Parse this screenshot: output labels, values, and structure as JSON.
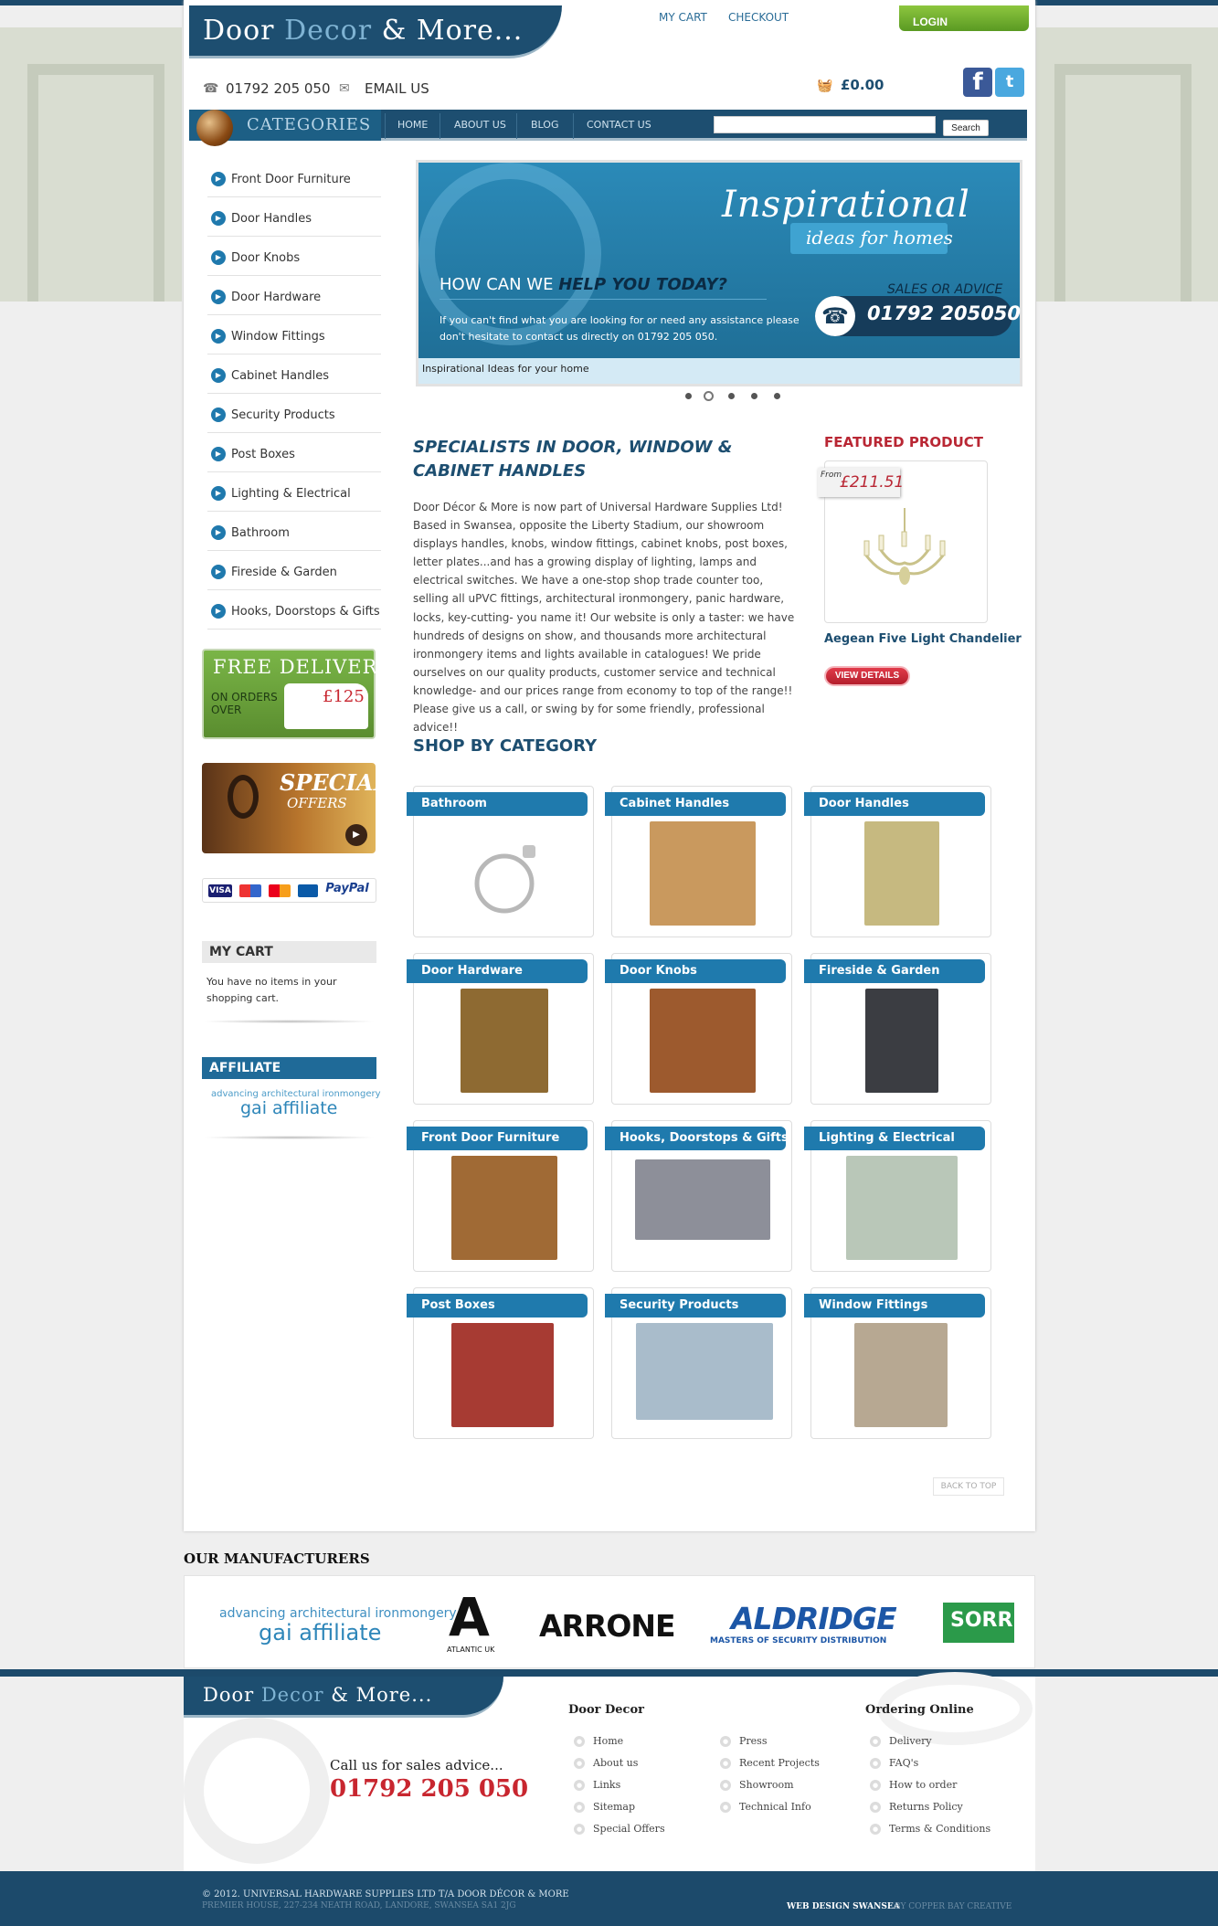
{
  "header": {
    "logo": {
      "part1": "Door ",
      "part2": "Decor",
      "part3": " & More..."
    },
    "links": {
      "my_cart": "MY CART",
      "checkout": "CHECKOUT",
      "login": "LOGIN"
    },
    "phone": "01792 205 050",
    "email": "EMAIL US",
    "cart_total": "£0.00",
    "social": {
      "facebook_glyph": "f",
      "twitter_glyph": "t"
    }
  },
  "nav": {
    "categories_title": "CATEGORIES",
    "items": [
      "HOME",
      "ABOUT US",
      "BLOG",
      "CONTACT US"
    ],
    "search": {
      "value": "",
      "button": "Search"
    }
  },
  "sidebar": {
    "categories": [
      "Front Door Furniture",
      "Door Handles",
      "Door Knobs",
      "Door Hardware",
      "Window Fittings",
      "Cabinet Handles",
      "Security Products",
      "Post Boxes",
      "Lighting & Electrical",
      "Bathroom",
      "Fireside & Garden",
      "Hooks, Doorstops & Gifts"
    ],
    "free_delivery": {
      "title": "FREE DELIVERY",
      "sub1": "ON ORDERS",
      "sub2": "OVER",
      "price": "£125"
    },
    "special_offers": {
      "title": "SPECIAL",
      "sub": "OFFERS"
    },
    "payments": [
      "VISA",
      "",
      "",
      "",
      "PayPal"
    ],
    "my_cart": {
      "title": "MY CART",
      "text": "You have no items in your shopping cart."
    },
    "affiliate": {
      "title": "AFFILIATE",
      "small": "advancing architectural ironmongery",
      "big": "gai affiliate"
    }
  },
  "banner": {
    "title": "Inspirational",
    "subtitle": "ideas for homes",
    "question_a": "HOW CAN WE ",
    "question_b": "HELP YOU TODAY?",
    "text": "If you can't find what you are looking for or need any assistance please don't hesitate to contact us directly on 01792 205 050.",
    "sales": "SALES OR ADVICE",
    "phone": "01792 205050",
    "caption": "Inspirational Ideas for your home",
    "active_slide": 2,
    "slide_count": 5
  },
  "intro": {
    "title": "SPECIALISTS IN DOOR, WINDOW & CABINET HANDLES",
    "body": "Door Décor & More is now part of Universal Hardware Supplies Ltd! Based in Swansea, opposite the Liberty Stadium, our showroom displays handles, knobs, window fittings, cabinet knobs, post boxes, letter plates...and has a growing display of lighting, lamps and electrical switches. We have a one-stop shop trade counter too, selling all uPVC fittings, architectural ironmongery, panic hardware, locks, key-cutting- you name it! Our website is only a taster: we have hundreds of designs on show, and thousands more architectural ironmongery items and lights available in catalogues! We pride ourselves on our quality products, customer service and technical knowledge- and our prices range from economy to top of the range!! Please give us a call, or swing by for some friendly, professional advice!!"
  },
  "featured": {
    "title": "FEATURED PRODUCT",
    "from": "From",
    "price": "£211.51",
    "name": "Aegean Five Light Chandelier",
    "button": "VIEW DETAILS"
  },
  "shop": {
    "title": "SHOP BY CATEGORY",
    "tiles": [
      {
        "label": "Bathroom",
        "color": "#f2f2f2"
      },
      {
        "label": "Cabinet Handles",
        "color": "#c9995e"
      },
      {
        "label": "Door Handles",
        "color": "#c6b980"
      },
      {
        "label": "Door Hardware",
        "color": "#8e6a32"
      },
      {
        "label": "Door Knobs",
        "color": "#9d5a2e"
      },
      {
        "label": "Fireside & Garden",
        "color": "#3b3d42"
      },
      {
        "label": "Front Door Furniture",
        "color": "#a06a35"
      },
      {
        "label": "Hooks, Doorstops & Gifts",
        "color": "#8d8f99"
      },
      {
        "label": "Lighting & Electrical",
        "color": "#b9c7b8"
      },
      {
        "label": "Post Boxes",
        "color": "#a73b33"
      },
      {
        "label": "Security Products",
        "color": "#a9bccb"
      },
      {
        "label": "Window Fittings",
        "color": "#b7a892"
      }
    ],
    "back_to_top": "BACK TO TOP"
  },
  "manufacturers": {
    "title": "OUR MANUFACTURERS",
    "gai_small": "advancing architectural ironmongery",
    "gai_big": "gai affiliate",
    "atlantic_mark": "A",
    "atlantic_sub": "ATLANTIC UK",
    "arrone": "ARRONE",
    "aldridge": "ALDRIDGE",
    "aldridge_sub": "MASTERS OF SECURITY DISTRIBUTION",
    "sorrento": "SORR"
  },
  "footer": {
    "logo": {
      "part1": "Door ",
      "part2": "Decor",
      "part3": " & More..."
    },
    "callus": "Call us for sales advice...",
    "phone": "01792 205 050",
    "col1_title": "Door Decor",
    "col1": [
      "Home",
      "About us",
      "Links",
      "Sitemap",
      "Special Offers"
    ],
    "col2": [
      "Press",
      "Recent Projects",
      "Showroom",
      "Technical Info"
    ],
    "col3_title": "Ordering Online",
    "col3": [
      "Delivery",
      "FAQ's",
      "How to order",
      "Returns Policy",
      "Terms & Conditions"
    ],
    "copyright": "© 2012. UNIVERSAL HARDWARE SUPPLIES LTD T/A DOOR DÉCOR & MORE",
    "address": "PREMIER HOUSE, 227-234 NEATH ROAD, LANDORE, SWANSEA SA1 2JG",
    "credit": "WEB DESIGN SWANSEA",
    "credit_by": "BY COPPER BAY CREATIVE"
  }
}
